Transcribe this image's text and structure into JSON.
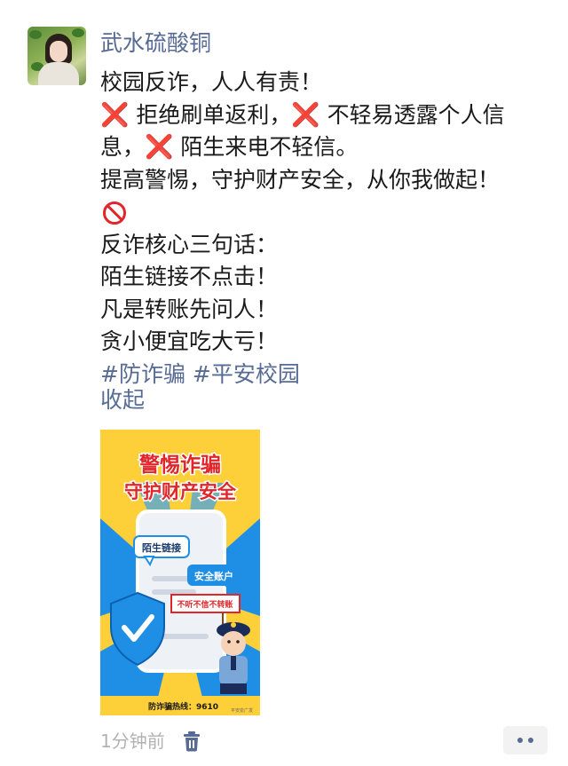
{
  "post": {
    "username": "武水硫酸铜",
    "lines": {
      "l1": "校园反诈，人人有责！",
      "x_mark": "❌",
      "l2a": "拒绝刷单返利，",
      "l2b": "不轻易透露个人信息，",
      "l2c": "陌生来电不轻信。",
      "l3": "提高警惕，守护财产安全，从你我做起！",
      "l4": "反诈核心三句话：",
      "l5": "陌生链接不点击！",
      "l6": "凡是转账先问人！",
      "l7": "贪小便宜吃大亏！"
    },
    "tags": "#防诈骗 #平安校园",
    "collapse_label": "收起",
    "time": "1分钟前"
  },
  "poster": {
    "title1": "警惕诈骗",
    "title2": "守护财产安全",
    "bubble1": "陌生链接",
    "bubble2": "安全账户",
    "sign": "不听不信不转账",
    "hotline": "防诈骗热线：9610",
    "credit": "平安泉广发",
    "colors": {
      "yellow": "#fdd03a",
      "blue": "#1f8fe5",
      "red": "#e0262b"
    }
  },
  "icons": {
    "avatar": "profile-photo",
    "delete": "trash-icon",
    "more": "more-dots-icon"
  },
  "colors": {
    "link": "#576b95",
    "text": "#1a1a1a",
    "muted": "#b2b2b2",
    "cross": "#e11d21"
  }
}
